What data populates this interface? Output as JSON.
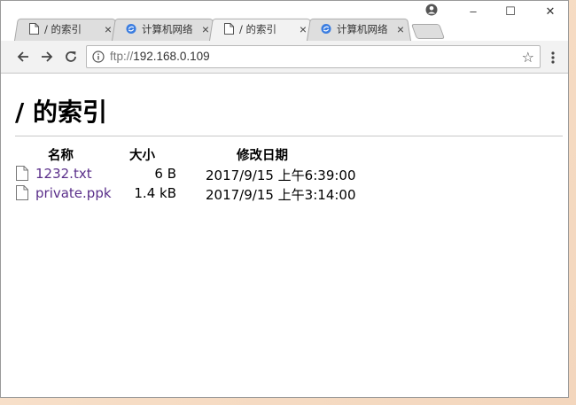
{
  "tabs": [
    {
      "label": "/ 的索引",
      "icon": "page-icon",
      "active": false
    },
    {
      "label": "计算机网络",
      "icon": "browser-logo-icon",
      "active": false
    },
    {
      "label": "/ 的索引",
      "icon": "page-icon",
      "active": true
    },
    {
      "label": "计算机网络",
      "icon": "browser-logo-icon",
      "active": false
    }
  ],
  "tab_close_glyph": "×",
  "window_controls": {
    "minimize": "–",
    "maximize": "☐",
    "close": "✕"
  },
  "address_bar": {
    "scheme": "ftp://",
    "host": "192.168.0.109"
  },
  "page": {
    "title": "/ 的索引",
    "columns": {
      "name": "名称",
      "size": "大小",
      "modified": "修改日期"
    },
    "files": [
      {
        "name": "1232.txt",
        "size": "6 B",
        "modified": "2017/9/15 上午6:39:00"
      },
      {
        "name": "private.ppk",
        "size": "1.4 kB",
        "modified": "2017/9/15 上午3:14:00"
      }
    ]
  },
  "colors": {
    "link_visited": "#5a2f8a",
    "accent_logo": "#3b7de0"
  }
}
